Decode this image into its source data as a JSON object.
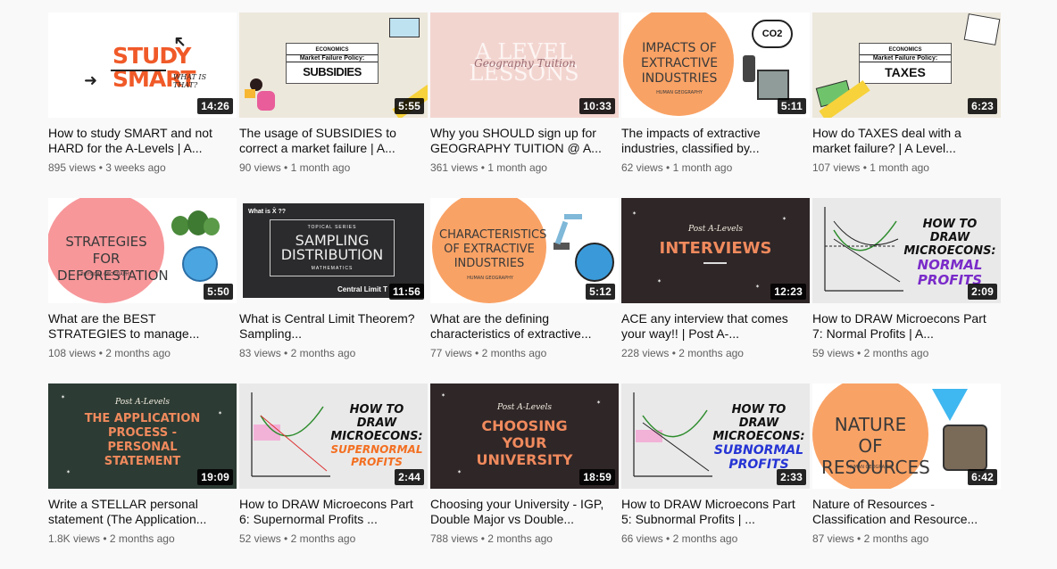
{
  "videos": [
    {
      "title": "How to study SMART and not HARD for the A-Levels | A...",
      "views": "895 views",
      "age": "3 weeks ago",
      "duration": "14:26",
      "thumb": {
        "line1": "STUDY",
        "line2": "SMART",
        "tag": "WHAT IS THAT?"
      }
    },
    {
      "title": "The usage of SUBSIDIES to correct a market failure | A...",
      "views": "90 views",
      "age": "1 month ago",
      "duration": "5:55",
      "thumb": {
        "subject": "ECONOMICS",
        "policy": "Market Failure Policy:",
        "main": "SUBSIDIES"
      }
    },
    {
      "title": "Why you SHOULD sign up for GEOGRAPHY TUITION @ A...",
      "views": "361 views",
      "age": "1 month ago",
      "duration": "10:33",
      "thumb": {
        "big": "A LEVEL LESSONS",
        "script": "Geography Tuition"
      }
    },
    {
      "title": "The impacts of extractive industries, classified by...",
      "views": "62 views",
      "age": "1 month ago",
      "duration": "5:11",
      "thumb": {
        "main": "IMPACTS OF EXTRACTIVE INDUSTRIES",
        "sub": "HUMAN GEOGRAPHY",
        "co2": "CO2"
      }
    },
    {
      "title": "How do TAXES deal with a market failure? | A Level...",
      "views": "107 views",
      "age": "1 month ago",
      "duration": "6:23",
      "thumb": {
        "subject": "ECONOMICS",
        "policy": "Market Failure Policy:",
        "main": "TAXES"
      }
    },
    {
      "title": "What are the BEST STRATEGIES to manage...",
      "views": "108 views",
      "age": "2 months ago",
      "duration": "5:50",
      "thumb": {
        "main": "STRATEGIES FOR DEFORESTATION",
        "sub": "PHYSICAL GEOGRAPHY"
      }
    },
    {
      "title": "What is Central Limit Theorem? Sampling...",
      "views": "83 views",
      "age": "2 months ago",
      "duration": "11:56",
      "thumb": {
        "corner": "What is X̄ ??",
        "series": "TOPICAL SERIES",
        "main": "SAMPLING DISTRIBUTION",
        "sub": "MATHEMATICS",
        "foot": "Central Limit T"
      }
    },
    {
      "title": "What are the defining characteristics of extractive...",
      "views": "77 views",
      "age": "2 months ago",
      "duration": "5:12",
      "thumb": {
        "main": "CHARACTERISTICS OF EXTRACTIVE INDUSTRIES",
        "sub": "HUMAN GEOGRAPHY"
      }
    },
    {
      "title": "ACE any interview that comes your way!! | Post A-...",
      "views": "228 views",
      "age": "2 months ago",
      "duration": "12:23",
      "thumb": {
        "top": "Post A-Levels",
        "main": "INTERVIEWS"
      }
    },
    {
      "title": "How to DRAW Microecons Part 7: Normal Profits | A...",
      "views": "59 views",
      "age": "2 months ago",
      "duration": "2:09",
      "thumb": {
        "line1": "HOW TO DRAW",
        "line2": "MICROECONS:",
        "line3": "NORMAL PROFITS"
      }
    },
    {
      "title": "Write a STELLAR personal statement (The Application...",
      "views": "1.8K views",
      "age": "2 months ago",
      "duration": "19:09",
      "thumb": {
        "top": "Post A-Levels",
        "main": "THE APPLICATION PROCESS - PERSONAL STATEMENT"
      }
    },
    {
      "title": "How to DRAW Microecons Part 6: Supernormal Profits ...",
      "views": "52 views",
      "age": "2 months ago",
      "duration": "2:44",
      "thumb": {
        "line1": "HOW TO DRAW",
        "line2": "MICROECONS:",
        "line3": "SUPERNORMAL PROFITS"
      }
    },
    {
      "title": "Choosing your University - IGP, Double Major vs Double...",
      "views": "788 views",
      "age": "2 months ago",
      "duration": "18:59",
      "thumb": {
        "top": "Post A-Levels",
        "main": "CHOOSING YOUR UNIVERSITY"
      }
    },
    {
      "title": "How to DRAW Microecons Part 5: Subnormal Profits | ...",
      "views": "66 views",
      "age": "2 months ago",
      "duration": "2:33",
      "thumb": {
        "line1": "HOW TO DRAW",
        "line2": "MICROECONS:",
        "line3": "SUBNORMAL PROFITS"
      }
    },
    {
      "title": "Nature of Resources - Classification and Resource...",
      "views": "87 views",
      "age": "2 months ago",
      "duration": "6:42",
      "thumb": {
        "main": "NATURE OF RESOURCES",
        "sub": "HUMAN GEOGRAPHY"
      }
    }
  ],
  "colors": {
    "orange": "#f9a265",
    "pink": "#f7979a",
    "chalkboard": "#2f2627",
    "green_board": "#2c3b33",
    "econ_orange": "#f36f21",
    "econ_blue": "#2534d4",
    "econ_purple": "#7a2bc9"
  }
}
